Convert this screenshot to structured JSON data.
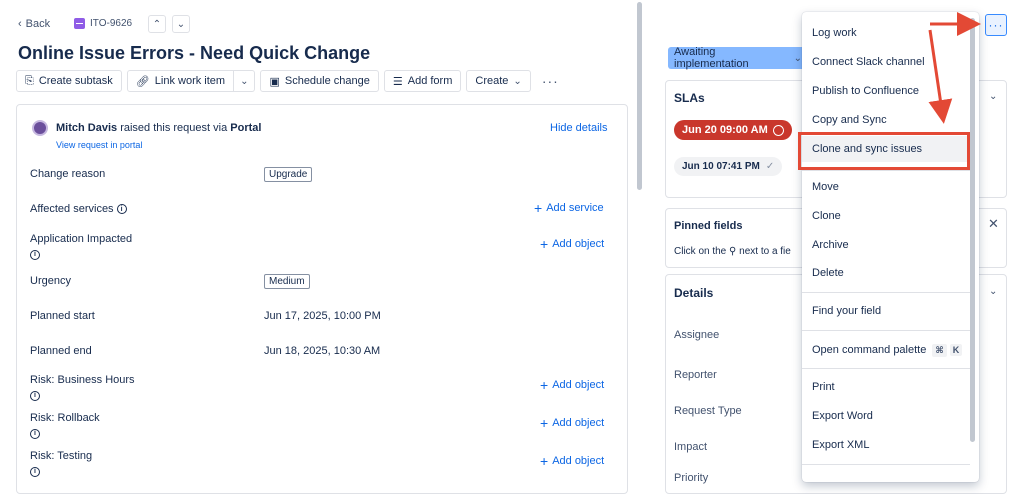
{
  "nav": {
    "back_label": "Back",
    "issue_key": "ITO-9626",
    "up_icon": "chevron-up-icon",
    "down_icon": "chevron-down-icon"
  },
  "issue": {
    "title": "Online Issue Errors - Need Quick Change"
  },
  "toolbar": {
    "create_subtask": "Create subtask",
    "link_work_item": "Link work item",
    "schedule_change": "Schedule change",
    "add_form": "Add form",
    "create": "Create",
    "more": "···"
  },
  "request": {
    "requester": "Mitch Davis",
    "raised_text": "raised this request via",
    "channel": "Portal",
    "view_portal": "View request in portal",
    "hide_details": "Hide details"
  },
  "fields": {
    "change_reason": {
      "label": "Change reason",
      "value": "Upgrade"
    },
    "affected_services": {
      "label": "Affected services",
      "action": "Add service"
    },
    "application_impacted": {
      "label": "Application Impacted",
      "action": "Add object"
    },
    "urgency": {
      "label": "Urgency",
      "value": "Medium"
    },
    "planned_start": {
      "label": "Planned start",
      "value": "Jun 17, 2025, 10:00 PM"
    },
    "planned_end": {
      "label": "Planned end",
      "value": "Jun 18, 2025, 10:30 AM"
    },
    "risk_business_hours": {
      "label": "Risk: Business Hours",
      "action": "Add object"
    },
    "risk_rollback": {
      "label": "Risk: Rollback",
      "action": "Add object"
    },
    "risk_testing": {
      "label": "Risk: Testing",
      "action": "Add object"
    }
  },
  "sidebar": {
    "status": "Awaiting implementation",
    "slas_title": "SLAs",
    "sla_breached": "Jun 20 09:00 AM",
    "sla_met": "Jun 10 07:41 PM",
    "pinned_title": "Pinned fields",
    "pinned_text": "Click on the",
    "pinned_text2": "next to a fie",
    "details_title": "Details",
    "assignee": "Assignee",
    "reporter": "Reporter",
    "request_type": "Request Type",
    "impact": "Impact",
    "priority": "Priority"
  },
  "menu": {
    "items": [
      "Log work",
      "Connect Slack channel",
      "Publish to Confluence",
      "Copy and Sync",
      "Clone and sync issues",
      "Move",
      "Clone",
      "Archive",
      "Delete",
      "Find your field",
      "Open command palette",
      "Print",
      "Export Word",
      "Export XML"
    ],
    "shortcut_mod": "⌘",
    "shortcut_key": "K",
    "highlighted": "Clone and sync issues"
  },
  "colors": {
    "accent": "#0c66e4",
    "status_bg": "#85b8ff",
    "sla_breached": "#c9372c",
    "annotation": "#e34935"
  }
}
